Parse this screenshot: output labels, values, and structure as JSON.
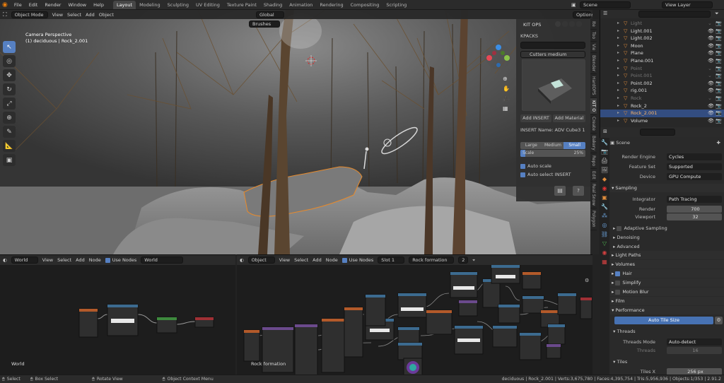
{
  "topbar": {
    "menu": [
      "File",
      "Edit",
      "Render",
      "Window",
      "Help"
    ],
    "workspaces": [
      "Layout",
      "Modeling",
      "Sculpting",
      "UV Editing",
      "Texture Paint",
      "Shading",
      "Animation",
      "Rendering",
      "Compositing",
      "Scripting"
    ],
    "active_workspace": "Layout",
    "scene": "Scene",
    "view_layer": "View Layer"
  },
  "viewport": {
    "mode": "Object Mode",
    "menus": [
      "View",
      "Select",
      "Add",
      "Object"
    ],
    "transform_orientation": "Global",
    "options": "Options",
    "brushes": "Brushes",
    "info_line1": "Camera Perspective",
    "info_line2": "(1) deciduous | Rock_2.001"
  },
  "kitops": {
    "title": "KIT OPS",
    "kpacks_label": "KPACKS",
    "kpack_selected": "Cutters medium",
    "add_insert": "Add INSERT",
    "add_material": "Add Material",
    "insert_name": "INSERT Name: ADV Cube3 1",
    "size_options": [
      "Large",
      "Medium",
      "Small"
    ],
    "size_selected": "Small",
    "scale_label": "Scale",
    "scale_value": "25%",
    "auto_scale": "Auto scale",
    "auto_select": "Auto select INSERT"
  },
  "sidebar_tabs": [
    "Ite",
    "Too",
    "Vie",
    "Blender",
    "HardOPS",
    "KIT O",
    "Create",
    "Bakery",
    "Repo",
    "Edit",
    "Real Snow",
    "Polygon"
  ],
  "node_left": {
    "menus": [
      "View",
      "Select",
      "Add",
      "Node"
    ],
    "type": "World",
    "use_nodes": "Use Nodes",
    "datablock": "World",
    "label": "World"
  },
  "node_right": {
    "object": "Object",
    "menus": [
      "View",
      "Select",
      "Add",
      "Node"
    ],
    "use_nodes": "Use Nodes",
    "slot": "Slot 1",
    "material": "Rock formation",
    "users": "2",
    "label": "Rock formation"
  },
  "outliner": {
    "rows": [
      {
        "name": "Light",
        "dim": true
      },
      {
        "name": "Light.001",
        "dim": false
      },
      {
        "name": "Light.002",
        "dim": false
      },
      {
        "name": "Moon",
        "dim": false
      },
      {
        "name": "Plane",
        "dim": false
      },
      {
        "name": "Plane.001",
        "dim": false
      },
      {
        "name": "Point",
        "dim": true
      },
      {
        "name": "Point.001",
        "dim": true
      },
      {
        "name": "Point.002",
        "dim": false
      },
      {
        "name": "rig.001",
        "dim": false
      },
      {
        "name": "Rock",
        "dim": true
      },
      {
        "name": "Rock_2",
        "dim": false
      },
      {
        "name": "Rock_2.001",
        "dim": false,
        "selected": true
      },
      {
        "name": "Volume",
        "dim": false
      }
    ]
  },
  "properties": {
    "scene_name": "Scene",
    "render_engine_label": "Render Engine",
    "render_engine": "Cycles",
    "feature_set_label": "Feature Set",
    "feature_set": "Supported",
    "device_label": "Device",
    "device": "GPU Compute",
    "sampling": "Sampling",
    "integrator_label": "Integrator",
    "integrator": "Path Tracing",
    "render_label": "Render",
    "render_value": "700",
    "viewport_label": "Viewport",
    "viewport_value": "32",
    "adaptive_sampling": "Adaptive Sampling",
    "denoising": "Denoising",
    "advanced": "Advanced",
    "light_paths": "Light Paths",
    "volumes": "Volumes",
    "hair": "Hair",
    "simplify": "Simplify",
    "motion_blur": "Motion Blur",
    "film": "Film",
    "performance": "Performance",
    "auto_tile_size": "Auto Tile Size",
    "threads": "Threads",
    "threads_mode_label": "Threads Mode",
    "threads_mode": "Auto-detect",
    "threads_label": "Threads",
    "threads_value": "16",
    "tiles": "Tiles",
    "tiles_x_label": "Tiles X",
    "tiles_x_value": "256 px"
  },
  "statusbar": {
    "select": "Select",
    "box_select": "Box Select",
    "rotate_view": "Rotate View",
    "context_menu": "Object Context Menu",
    "stats": "deciduous | Rock_2.001 | Verts:3,675,780 | Faces:4,395,754 | Tris:5,956,936 | Objects:1/353 | 2.91.2"
  }
}
